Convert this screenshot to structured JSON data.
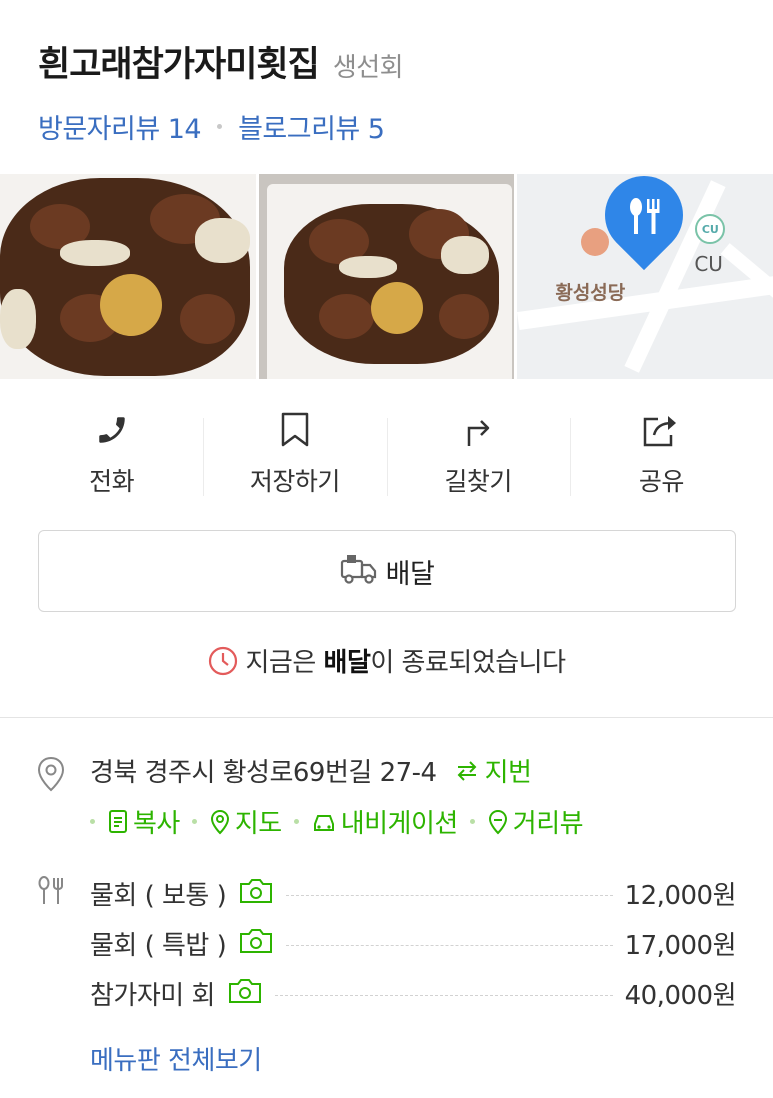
{
  "place": {
    "name": "흰고래참가자미횟집",
    "category": "생선회"
  },
  "reviews": {
    "visitor_label": "방문자리뷰",
    "visitor_count": "14",
    "blog_label": "블로그리뷰",
    "blog_count": "5"
  },
  "map": {
    "church_label": "황성성당",
    "cu_badge": "CU",
    "cu_label": "CU"
  },
  "actions": {
    "call": "전화",
    "save": "저장하기",
    "directions": "길찾기",
    "share": "공유"
  },
  "delivery": {
    "button_label": "배달",
    "notice_prefix": "지금은 ",
    "notice_bold": "배달",
    "notice_suffix": "이 종료되었습니다"
  },
  "address": {
    "road": "경북 경주시 황성로69번길 27-4",
    "jibun_label": "지번",
    "links": {
      "copy": "복사",
      "map": "지도",
      "navigation": "내비게이션",
      "street_view": "거리뷰"
    }
  },
  "menu": {
    "items": [
      {
        "name": "물회 ( 보통 )",
        "price": "12,000원"
      },
      {
        "name": "물회 ( 특밥 )",
        "price": "17,000원"
      },
      {
        "name": "참가자미 회",
        "price": "40,000원"
      }
    ],
    "view_all": "메뉴판 전체보기"
  },
  "colors": {
    "link_blue": "#3a6ec0",
    "green": "#2db400",
    "pin_blue": "#2f86e8",
    "clock_red": "#e35b5b"
  }
}
